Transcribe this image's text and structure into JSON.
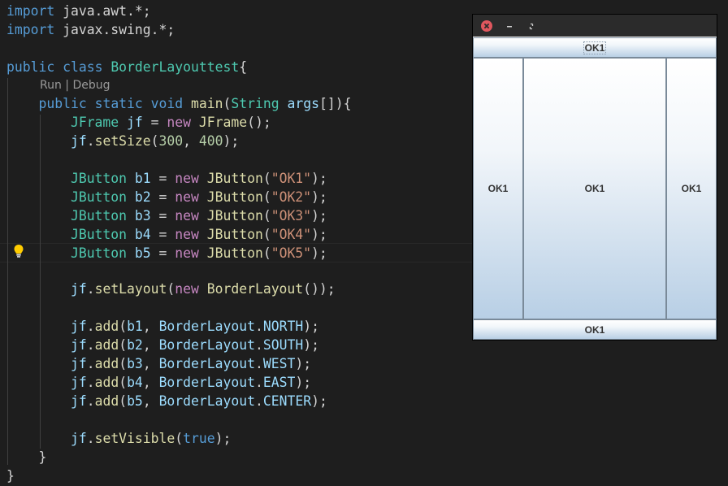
{
  "editor": {
    "codelens": {
      "run": "Run",
      "separator": " | ",
      "debug": "Debug"
    },
    "code_lines": [
      [
        [
          "k",
          "import"
        ],
        [
          "p",
          " java.awt.*;"
        ]
      ],
      [
        [
          "k",
          "import"
        ],
        [
          "p",
          " javax.swing.*;"
        ]
      ],
      [],
      [
        [
          "k",
          "public"
        ],
        [
          "p",
          " "
        ],
        [
          "k",
          "class"
        ],
        [
          "p",
          " "
        ],
        [
          "t",
          "BorderLayouttest"
        ],
        [
          "p",
          "{"
        ]
      ],
      [
        [
          "p",
          "    "
        ],
        [
          "k",
          "public"
        ],
        [
          "p",
          " "
        ],
        [
          "k",
          "static"
        ],
        [
          "p",
          " "
        ],
        [
          "k",
          "void"
        ],
        [
          "p",
          " "
        ],
        [
          "f",
          "main"
        ],
        [
          "p",
          "("
        ],
        [
          "t",
          "String"
        ],
        [
          "p",
          " "
        ],
        [
          "v",
          "args"
        ],
        [
          "p",
          "[]){"
        ]
      ],
      [
        [
          "p",
          "        "
        ],
        [
          "t",
          "JFrame"
        ],
        [
          "p",
          " "
        ],
        [
          "v",
          "jf"
        ],
        [
          "p",
          " = "
        ],
        [
          "kc",
          "new"
        ],
        [
          "p",
          " "
        ],
        [
          "f",
          "JFrame"
        ],
        [
          "p",
          "();"
        ]
      ],
      [
        [
          "p",
          "        "
        ],
        [
          "v",
          "jf"
        ],
        [
          "p",
          "."
        ],
        [
          "f",
          "setSize"
        ],
        [
          "p",
          "("
        ],
        [
          "n",
          "300"
        ],
        [
          "p",
          ", "
        ],
        [
          "n",
          "400"
        ],
        [
          "p",
          ");"
        ]
      ],
      [],
      [
        [
          "p",
          "        "
        ],
        [
          "t",
          "JButton"
        ],
        [
          "p",
          " "
        ],
        [
          "v",
          "b1"
        ],
        [
          "p",
          " = "
        ],
        [
          "kc",
          "new"
        ],
        [
          "p",
          " "
        ],
        [
          "f",
          "JButton"
        ],
        [
          "p",
          "("
        ],
        [
          "s",
          "\"OK1\""
        ],
        [
          "p",
          ");"
        ]
      ],
      [
        [
          "p",
          "        "
        ],
        [
          "t",
          "JButton"
        ],
        [
          "p",
          " "
        ],
        [
          "v",
          "b2"
        ],
        [
          "p",
          " = "
        ],
        [
          "kc",
          "new"
        ],
        [
          "p",
          " "
        ],
        [
          "f",
          "JButton"
        ],
        [
          "p",
          "("
        ],
        [
          "s",
          "\"OK2\""
        ],
        [
          "p",
          ");"
        ]
      ],
      [
        [
          "p",
          "        "
        ],
        [
          "t",
          "JButton"
        ],
        [
          "p",
          " "
        ],
        [
          "v",
          "b3"
        ],
        [
          "p",
          " = "
        ],
        [
          "kc",
          "new"
        ],
        [
          "p",
          " "
        ],
        [
          "f",
          "JButton"
        ],
        [
          "p",
          "("
        ],
        [
          "s",
          "\"OK3\""
        ],
        [
          "p",
          ");"
        ]
      ],
      [
        [
          "p",
          "        "
        ],
        [
          "t",
          "JButton"
        ],
        [
          "p",
          " "
        ],
        [
          "v",
          "b4"
        ],
        [
          "p",
          " = "
        ],
        [
          "kc",
          "new"
        ],
        [
          "p",
          " "
        ],
        [
          "f",
          "JButton"
        ],
        [
          "p",
          "("
        ],
        [
          "s",
          "\"OK4\""
        ],
        [
          "p",
          ");"
        ]
      ],
      [
        [
          "p",
          "        "
        ],
        [
          "t",
          "JButton"
        ],
        [
          "p",
          " "
        ],
        [
          "v",
          "b5"
        ],
        [
          "p",
          " = "
        ],
        [
          "kc",
          "new"
        ],
        [
          "p",
          " "
        ],
        [
          "f",
          "JButton"
        ],
        [
          "p",
          "("
        ],
        [
          "s",
          "\"OK5\""
        ],
        [
          "p",
          ");"
        ]
      ],
      [],
      [
        [
          "p",
          "        "
        ],
        [
          "v",
          "jf"
        ],
        [
          "p",
          "."
        ],
        [
          "f",
          "setLayout"
        ],
        [
          "p",
          "("
        ],
        [
          "kc",
          "new"
        ],
        [
          "p",
          " "
        ],
        [
          "f",
          "BorderLayout"
        ],
        [
          "p",
          "());"
        ]
      ],
      [],
      [
        [
          "p",
          "        "
        ],
        [
          "v",
          "jf"
        ],
        [
          "p",
          "."
        ],
        [
          "f",
          "add"
        ],
        [
          "p",
          "("
        ],
        [
          "v",
          "b1"
        ],
        [
          "p",
          ", "
        ],
        [
          "v",
          "BorderLayout"
        ],
        [
          "p",
          "."
        ],
        [
          "v",
          "NORTH"
        ],
        [
          "p",
          ");"
        ]
      ],
      [
        [
          "p",
          "        "
        ],
        [
          "v",
          "jf"
        ],
        [
          "p",
          "."
        ],
        [
          "f",
          "add"
        ],
        [
          "p",
          "("
        ],
        [
          "v",
          "b2"
        ],
        [
          "p",
          ", "
        ],
        [
          "v",
          "BorderLayout"
        ],
        [
          "p",
          "."
        ],
        [
          "v",
          "SOUTH"
        ],
        [
          "p",
          ");"
        ]
      ],
      [
        [
          "p",
          "        "
        ],
        [
          "v",
          "jf"
        ],
        [
          "p",
          "."
        ],
        [
          "f",
          "add"
        ],
        [
          "p",
          "("
        ],
        [
          "v",
          "b3"
        ],
        [
          "p",
          ", "
        ],
        [
          "v",
          "BorderLayout"
        ],
        [
          "p",
          "."
        ],
        [
          "v",
          "WEST"
        ],
        [
          "p",
          ");"
        ]
      ],
      [
        [
          "p",
          "        "
        ],
        [
          "v",
          "jf"
        ],
        [
          "p",
          "."
        ],
        [
          "f",
          "add"
        ],
        [
          "p",
          "("
        ],
        [
          "v",
          "b4"
        ],
        [
          "p",
          ", "
        ],
        [
          "v",
          "BorderLayout"
        ],
        [
          "p",
          "."
        ],
        [
          "v",
          "EAST"
        ],
        [
          "p",
          ");"
        ]
      ],
      [
        [
          "p",
          "        "
        ],
        [
          "v",
          "jf"
        ],
        [
          "p",
          "."
        ],
        [
          "f",
          "add"
        ],
        [
          "p",
          "("
        ],
        [
          "v",
          "b5"
        ],
        [
          "p",
          ", "
        ],
        [
          "v",
          "BorderLayout"
        ],
        [
          "p",
          "."
        ],
        [
          "v",
          "CENTER"
        ],
        [
          "p",
          ");"
        ]
      ],
      [],
      [
        [
          "p",
          "        "
        ],
        [
          "v",
          "jf"
        ],
        [
          "p",
          "."
        ],
        [
          "f",
          "setVisible"
        ],
        [
          "p",
          "("
        ],
        [
          "k",
          "true"
        ],
        [
          "p",
          ");"
        ]
      ],
      [
        [
          "p",
          "    }"
        ]
      ],
      [
        [
          "p",
          "}"
        ]
      ]
    ],
    "token_colors": {
      "k": "#569cd6",
      "kc": "#c586c0",
      "t": "#4ec9b0",
      "f": "#dcdcaa",
      "v": "#9cdcfe",
      "s": "#ce9178",
      "n": "#b5cea8",
      "p": "#d4d4d4"
    },
    "lightbulb_icon": "lightbulb-icon"
  },
  "swing_window": {
    "titlebar_icons": [
      "close-icon",
      "minimize-icon",
      "maximize-icon"
    ],
    "buttons": {
      "north": "OK1",
      "west": "OK1",
      "center": "OK1",
      "east": "OK1",
      "south": "OK1"
    }
  }
}
